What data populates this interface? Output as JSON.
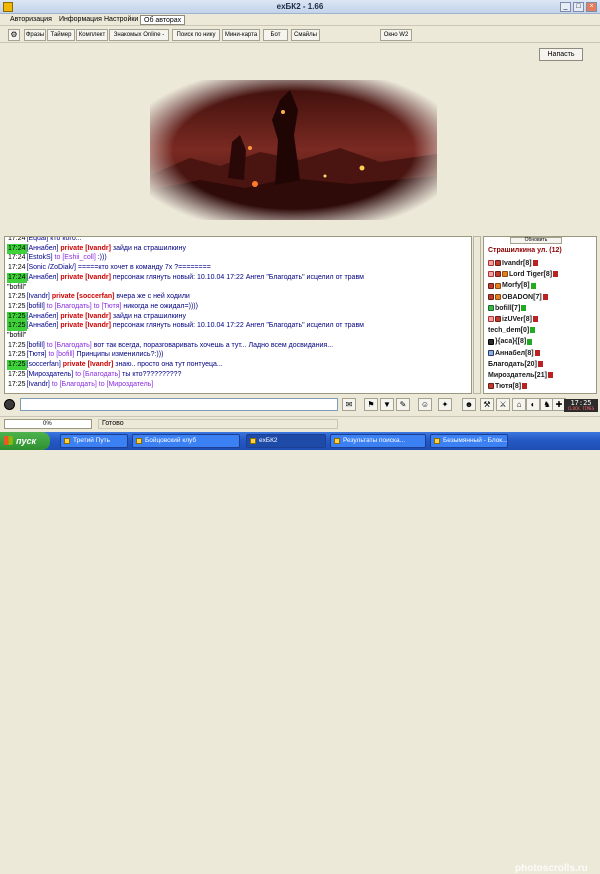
{
  "window": {
    "title": "exБК2 - 1.66",
    "minimize": "_",
    "maximize": "□",
    "close": "×"
  },
  "menu": [
    "Авторизация",
    "Информация",
    "Настройки",
    "Об авторах"
  ],
  "toolbar": {
    "grip": "⚙",
    "buttons": [
      "Фразы",
      "Таймер",
      "Комплект",
      "Знакомых Online -",
      "Поиск по нику",
      "Мини-карта",
      "Бот",
      "Смайлы",
      "Окно W2"
    ]
  },
  "attack_label": "Напасть",
  "chat": {
    "lines": [
      {
        "time": "17:24",
        "highlight": false,
        "from": "[Equal]",
        "private": "",
        "to": "",
        "text": "кто кого..."
      },
      {
        "time": "17:24",
        "highlight": true,
        "from": "[Аннабел]",
        "private": "private [Ivandr]",
        "to": "",
        "text": "зайди на страшилкину"
      },
      {
        "time": "17:24",
        "highlight": false,
        "from": "[EstokS]",
        "private": "",
        "to": "to [Eshii_coll]",
        "text": ":)))"
      },
      {
        "time": "17:24",
        "highlight": false,
        "from": "[Sonic /ZoDiak/]",
        "private": "",
        "to": "",
        "text": "=====кто хочет в команду 7x ?========"
      },
      {
        "time": "17:24",
        "highlight": true,
        "from": "[Аннабел]",
        "private": "private [Ivandr]",
        "to": "",
        "text": "персонаж глянуть новый: 10.10.04 17:22 Ангел \"Благодать\" исцелил от травм"
      },
      {
        "time": "",
        "highlight": false,
        "from": "",
        "private": "",
        "to": "",
        "text": "\"bofill\""
      },
      {
        "time": "17:25",
        "highlight": false,
        "from": "[Ivandr]",
        "private": "private [soccerfan]",
        "to": "",
        "text": "вчера же с ней ходили"
      },
      {
        "time": "17:25",
        "highlight": false,
        "from": "[bofill]",
        "private": "",
        "to": "to [Благодать] to [Тютя]",
        "text": "никогда не ожидал=))))"
      },
      {
        "time": "17:25",
        "highlight": true,
        "from": "[Аннабел]",
        "private": "private [Ivandr]",
        "to": "",
        "text": "зайди на страшилкину"
      },
      {
        "time": "17:25",
        "highlight": true,
        "from": "[Аннабел]",
        "private": "private [Ivandr]",
        "to": "",
        "text": "персонаж глянуть новый: 10.10.04 17:22 Ангел \"Благодать\" исцелил от травм"
      },
      {
        "time": "",
        "highlight": false,
        "from": "",
        "private": "",
        "to": "",
        "text": "\"bofill\""
      },
      {
        "time": "17:25",
        "highlight": false,
        "from": "[bofill]",
        "private": "",
        "to": "to [Благодать]",
        "text": "вот так всегда, поразговаривать хочешь а тут... Ладно всем досвидания..."
      },
      {
        "time": "17:25",
        "highlight": false,
        "from": "[Тютя]",
        "private": "",
        "to": "to [bofill]",
        "text": "Принципы изменились?:)))"
      },
      {
        "time": "17:25",
        "highlight": true,
        "from": "[soccerfan]",
        "private": "private [Ivandr]",
        "to": "",
        "text": "знаю.. просто она тут понтуеца..."
      },
      {
        "time": "17:25",
        "highlight": false,
        "from": "[Мироздатель]",
        "private": "",
        "to": "to [Благодать]",
        "text": "ты кто??????????"
      },
      {
        "time": "17:25",
        "highlight": false,
        "from": "[Ivandr]",
        "private": "",
        "to": "to [Благодать] to [Мироздатель]",
        "text": ""
      }
    ]
  },
  "roster": {
    "refresh_label": "Обновить",
    "location": "Страшилкина ул. (12)",
    "players": [
      {
        "name": "Ivandr[8]",
        "icons": [
          "a",
          "b"
        ],
        "info": "red"
      },
      {
        "name": "Lord Tiger[8]",
        "icons": [
          "a",
          "b",
          "d"
        ],
        "info": "red"
      },
      {
        "name": "Morfy[8]",
        "icons": [
          "b",
          "d"
        ],
        "info": "grn"
      },
      {
        "name": "OBADON[7]",
        "icons": [
          "b",
          "d"
        ],
        "info": "red"
      },
      {
        "name": "bofill[7]",
        "icons": [
          "f"
        ],
        "info": "grn"
      },
      {
        "name": "izUVer[8]",
        "icons": [
          "a",
          "b"
        ],
        "info": "red"
      },
      {
        "name": "tech_dem[0]",
        "icons": [],
        "info": "grn"
      },
      {
        "name": "}{аса}{[8]",
        "icons": [
          "e"
        ],
        "info": "grn"
      },
      {
        "name": "Аннабел[8]",
        "icons": [
          "c"
        ],
        "info": "red"
      },
      {
        "name": "Благодать[20]",
        "icons": [],
        "info": "red"
      },
      {
        "name": "Мироздатель[21]",
        "icons": [],
        "info": "red"
      },
      {
        "name": "Тютя[8]",
        "icons": [
          "b"
        ],
        "info": "red"
      }
    ]
  },
  "input": {
    "value": "",
    "buttons": [
      "✉",
      "⚑",
      "▼",
      "✎",
      "☺",
      "✦",
      "☻",
      "⚒",
      "⚔",
      "⌂",
      "◐",
      "♞",
      "✚"
    ]
  },
  "clock": {
    "time": "17:25",
    "sub": "CLOCK TIMES"
  },
  "status": {
    "progress_text": "0%",
    "progress_value": 0,
    "message": "Готово"
  },
  "taskbar": {
    "start_label": "пуск",
    "tasks": [
      "Третий Путь",
      "Бойцовский клуб",
      "exБК2",
      "Результаты поиска...",
      "Безымянный - Блок..."
    ],
    "active_task": 2,
    "watermark": "photoscrolls.ru"
  },
  "colors": {
    "window_bg": "#ece9d8",
    "chat_highlight": "#3fd13a",
    "private_red": "#cc0000",
    "taskbar_blue": "#2559c4"
  }
}
